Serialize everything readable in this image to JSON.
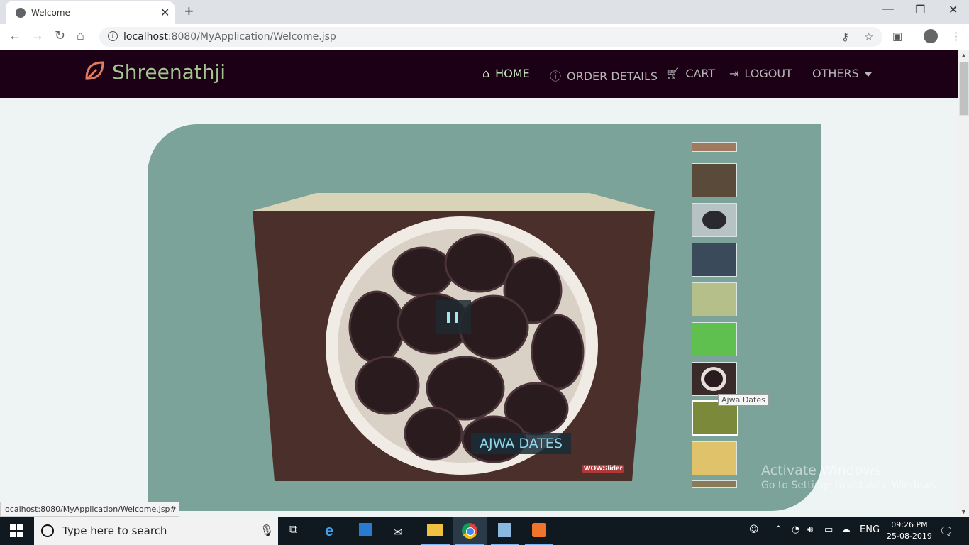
{
  "browser": {
    "tab_title": "Welcome",
    "url_host": "localhost",
    "url_path": ":8080/MyApplication/Welcome.jsp",
    "status_url": "localhost:8080/MyApplication/Welcome.jsp#"
  },
  "site": {
    "brand": "Shreenathji",
    "nav": [
      {
        "label": "HOME",
        "icon": "home-icon",
        "active": true
      },
      {
        "label": "ORDER DETAILS",
        "icon": "info-circle-icon"
      },
      {
        "label": "CART",
        "icon": "cart-icon"
      },
      {
        "label": "LOGOUT",
        "icon": "logout-icon"
      },
      {
        "label": "OTHERS",
        "icon": "caret-down-icon"
      }
    ]
  },
  "slider": {
    "caption": "AJWA DATES",
    "tooltip": "Ajwa Dates",
    "watermark_logo": "WOWSlider",
    "thumbnails": [
      "almonds",
      "spices",
      "dates",
      "chia-seeds",
      "raisins-green",
      "cardamom",
      "ajwa-dates",
      "green-raisins-bowl",
      "golden-raisins",
      "nuts"
    ]
  },
  "windows": {
    "activate_title": "Activate Windows",
    "activate_sub": "Go to Settings to activate Windows."
  },
  "taskbar": {
    "search_placeholder": "Type here to search",
    "lang": "ENG",
    "time": "09:26 PM",
    "date": "25-08-2019"
  },
  "colors": {
    "navbar_bg": "#1c0016",
    "brand": "#a2c58e",
    "panel_bg": "#7ba39a"
  }
}
